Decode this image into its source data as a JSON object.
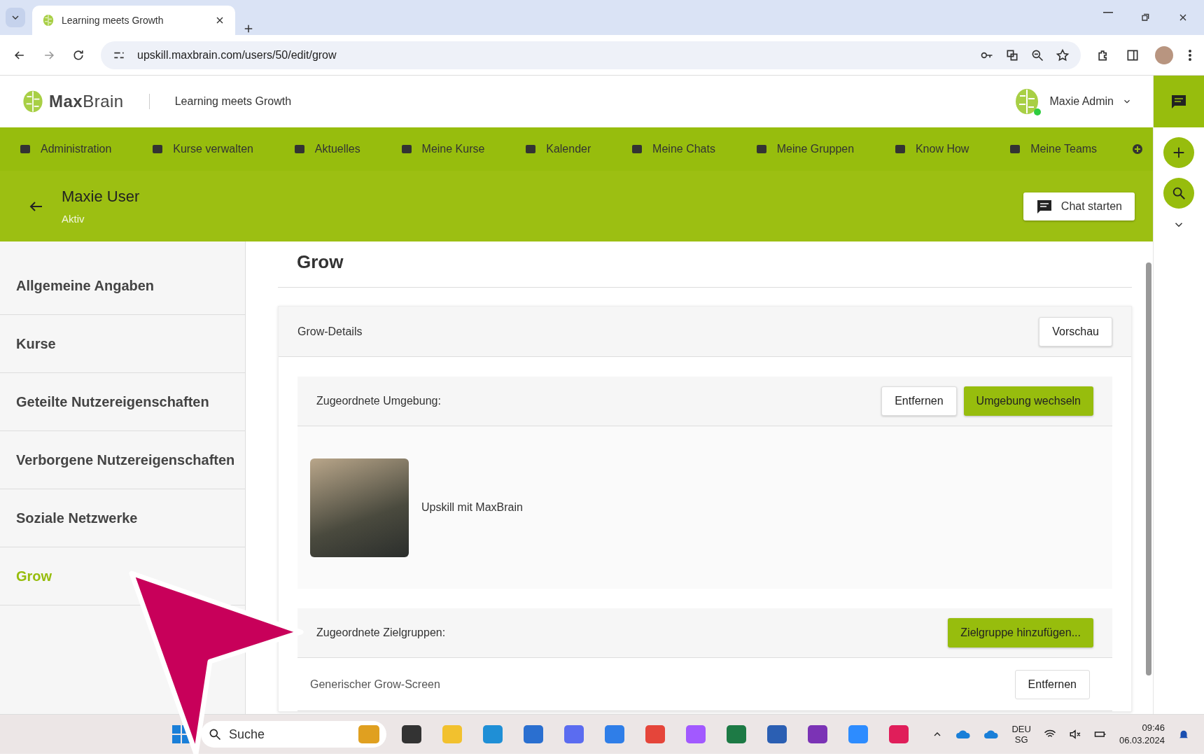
{
  "browser": {
    "tab_title": "Learning meets Growth",
    "url": "upskill.maxbrain.com/users/50/edit/grow"
  },
  "header": {
    "logo": "**Max**Brain",
    "tagline": "Learning meets Growth",
    "user": "Maxie Admin",
    "online": true
  },
  "nav": [
    "Administration",
    "Kurse verwalten",
    "Aktuelles",
    "Meine Kurse",
    "Kalender",
    "Meine Chats",
    "Meine Gruppen",
    "Know How",
    "Meine Teams"
  ],
  "profile": {
    "name": "Maxie User",
    "status": "Aktiv",
    "chat_button": "Chat starten"
  },
  "sidebar": [
    {
      "label": "Allgemeine Angaben",
      "selected": false
    },
    {
      "label": "Kurse",
      "selected": false
    },
    {
      "label": "Geteilte Nutzereigenschaften",
      "selected": false
    },
    {
      "label": "Verborgene Nutzereigenschaften",
      "selected": false
    },
    {
      "label": "Soziale Netzwerke",
      "selected": false
    },
    {
      "label": "Grow",
      "selected": true
    }
  ],
  "page": {
    "title": "Grow",
    "card_title": "Grow-Details",
    "preview_button": "Vorschau",
    "environment": {
      "label": "Zugeordnete Umgebung:",
      "remove_button": "Entfernen",
      "change_button": "Umgebung wechseln",
      "name": "Upskill mit MaxBrain"
    },
    "groups": {
      "label": "Zugeordnete Zielgruppen:",
      "add_button": "Zielgruppe hinzufügen...",
      "rows": [
        {
          "name": "Generischer Grow-Screen",
          "remove_button": "Entfernen"
        }
      ]
    }
  },
  "taskbar": {
    "search": "Suche",
    "language": "DEU",
    "region": "SG",
    "time": "09:46",
    "date": "06.03.2024"
  }
}
